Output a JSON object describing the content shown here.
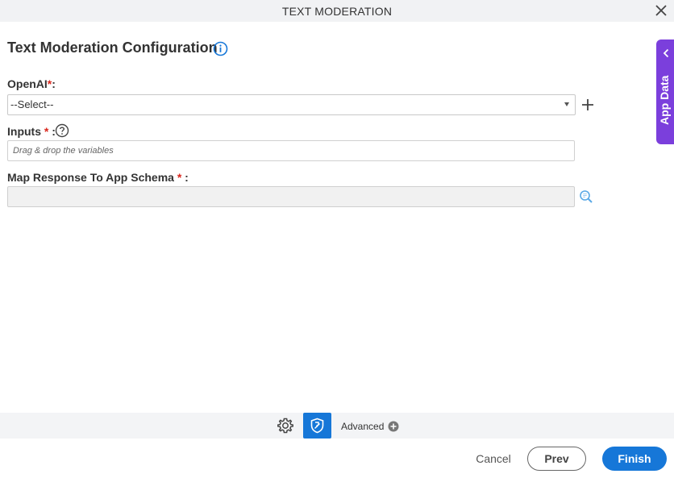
{
  "window": {
    "title": "TEXT MODERATION",
    "close_icon": "close-icon"
  },
  "heading": {
    "title": "Text Moderation Configuration",
    "info_icon": "info-icon"
  },
  "fields": {
    "openai": {
      "label": "OpenAI",
      "required_mark": "*",
      "suffix": ":",
      "value": "--Select--"
    },
    "inputs": {
      "label": "Inputs",
      "required_mark": "*",
      "suffix": ":",
      "placeholder": "Drag & drop the variables"
    },
    "map_response": {
      "label": "Map Response To App Schema",
      "required_mark": "*",
      "suffix": ":",
      "value": ""
    }
  },
  "side_panel": {
    "label": "App Data"
  },
  "toolbar": {
    "advanced_label": "Advanced"
  },
  "footer": {
    "cancel_label": "Cancel",
    "prev_label": "Prev",
    "finish_label": "Finish"
  },
  "colors": {
    "primary": "#1677d8",
    "app_data_tab": "#7b3fdc",
    "required": "#d9261c"
  }
}
